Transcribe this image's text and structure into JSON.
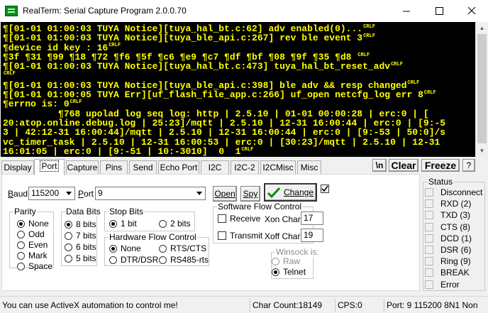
{
  "window": {
    "title": "RealTerm: Serial Capture Program 2.0.0.70",
    "controls": [
      "minimize",
      "maximize",
      "close"
    ]
  },
  "terminal": {
    "lines": [
      {
        "text": "¶[01-01 01:00:03 TUYA Notice][tuya_hal_bt.c:62] adv enabled(0)...",
        "end": "CRLF"
      },
      {
        "text": "¶[01-01 01:00:03 TUYA Notice][tuya_ble_api.c:267] rev ble event 3",
        "end": "CRLF"
      },
      {
        "text": "¶device id key : 16",
        "end": "CRLF"
      },
      {
        "text": "¶3f ¶31 ¶99 ¶18 ¶72 ¶f6 ¶5f ¶c6 ¶e9 ¶c7 ¶df ¶bf ¶08 ¶9f ¶35 ¶d8 ",
        "end": "CRLF"
      },
      {
        "text": "¶[01-01 01:00:03 TUYA Notice][tuya_hal_bt.c:473] tuya_hal_bt_reset_adv",
        "end": "CRLF"
      },
      {
        "text": "",
        "end": "CRLF"
      },
      {
        "text": "¶[01-01 01:00:03 TUYA Notice][tuya_ble_api.c:398] ble adv && resp changed",
        "end": "CRLF"
      },
      {
        "text": "¶[01-01 01:00:05 TUYA Err][uf_flash_file_app.c:266] uf_open netcfg_log err 8",
        "end": "CRLF"
      },
      {
        "text": "¶errno is: 0",
        "end": "CRLF"
      },
      {
        "text": "          ¶768 upolad log seq log: http | 2.5.10 | 01-01 00:00:28 | erc:0 | [",
        "end": ""
      },
      {
        "text": "20:atop.online.debug.log | 25:23]/mqtt | 2.5.10 | 12-31 16:00:44 | erc:0 | [9:-5",
        "end": ""
      },
      {
        "text": "3 | 42:12-31 16:00:44]/mqtt | 2.5.10 | 12-31 16:00:44 | erc:0 | [9:-53 | 50:0]/s",
        "end": ""
      },
      {
        "text": "vc_timer_task | 2.5.10 | 12-31 16:00:53 | erc:0 | [30:23]/mqtt | 2.5.10 | 12-31",
        "end": ""
      },
      {
        "text": "16:01:05 | erc:0 | [9:-51 | 10:-3010]  0  1",
        "end": "CRLF"
      }
    ],
    "crlf_label": "CRLF"
  },
  "tabs": [
    {
      "label": "Display",
      "active": false
    },
    {
      "label": "Port",
      "active": true
    },
    {
      "label": "Capture",
      "active": false
    },
    {
      "label": "Pins",
      "active": false
    },
    {
      "label": "Send",
      "active": false
    },
    {
      "label": "Echo Port",
      "active": false
    },
    {
      "label": "I2C",
      "active": false
    },
    {
      "label": "I2C-2",
      "active": false
    },
    {
      "label": "I2CMisc",
      "active": false
    },
    {
      "label": "Misc",
      "active": false
    }
  ],
  "toolbar": {
    "newline_label": "\\n",
    "clear_label": "Clear",
    "freeze_label": "Freeze",
    "help_label": "?"
  },
  "port": {
    "baud_label": "Baud",
    "baud_value": "115200",
    "port_label": "Port",
    "port_value": "9",
    "open_label": "Open",
    "spy_label": "Spy",
    "change_label": "Change",
    "parity": {
      "title": "Parity",
      "options": [
        "None",
        "Odd",
        "Even",
        "Mark",
        "Space"
      ],
      "selected": "None"
    },
    "data_bits": {
      "title": "Data Bits",
      "options": [
        "8 bits",
        "7 bits",
        "6 bits",
        "5 bits"
      ],
      "selected": "8 bits"
    },
    "stop_bits": {
      "title": "Stop Bits",
      "options": [
        "1 bit",
        "2 bits"
      ],
      "selected": "1 bit"
    },
    "hw_flow": {
      "title": "Hardware Flow Control",
      "options": [
        "None",
        "RTS/CTS",
        "DTR/DSR",
        "RS485-rts"
      ],
      "selected": "None"
    },
    "sw_flow": {
      "title": "Software Flow Control",
      "receive_label": "Receive",
      "transmit_label": "Transmit",
      "xon_label": "Xon Char:",
      "xon_value": "17",
      "xoff_label": "Xoff Char:",
      "xoff_value": "19"
    },
    "winsock": {
      "title": "Winsock is:",
      "options": [
        "Raw",
        "Telnet"
      ],
      "selected": "Telnet"
    }
  },
  "status": {
    "title": "Status",
    "items": [
      "Disconnect",
      "RXD (2)",
      "TXD (3)",
      "CTS (8)",
      "DCD (1)",
      "DSR (6)",
      "Ring (9)",
      "BREAK",
      "Error"
    ]
  },
  "statusbar": {
    "message": "You can use ActiveX automation to control me!",
    "char_count": "Char Count:18149",
    "cps": "CPS:0",
    "port_info": "Port: 9 115200 8N1 Non"
  },
  "colors": {
    "terminal_bg": "#000000",
    "terminal_fg": "#ffff00",
    "accent_green": "#0a8a0a"
  }
}
